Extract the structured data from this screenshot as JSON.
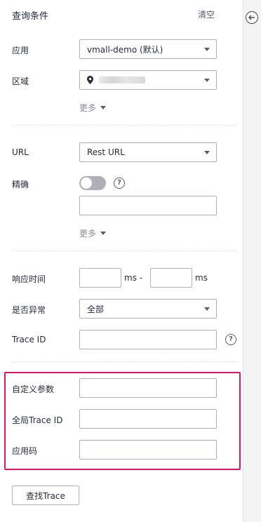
{
  "header": {
    "title": "查询条件",
    "clear_label": "清空"
  },
  "filters": {
    "app_label": "应用",
    "app_value": "vmall-demo (默认)",
    "region_label": "区域",
    "more_label": "更多",
    "url_label": "URL",
    "url_value": "Rest URL",
    "exact_label": "精确",
    "exact_on": false,
    "more_label_2": "更多",
    "response_time_label": "响应时间",
    "ms_unit_1": "ms",
    "range_sep": "-",
    "ms_unit_2": "ms",
    "abnormal_label": "是否异常",
    "abnormal_value": "全部",
    "trace_id_label": "Trace ID",
    "help_glyph": "?"
  },
  "custom": {
    "custom_param_label": "自定义参数",
    "global_trace_label": "全局Trace ID",
    "app_code_label": "应用码"
  },
  "actions": {
    "find_trace_label": "查找Trace"
  },
  "colors": {
    "highlight": "#e0156a",
    "border": "#adb0b8",
    "text": "#252b3a"
  }
}
